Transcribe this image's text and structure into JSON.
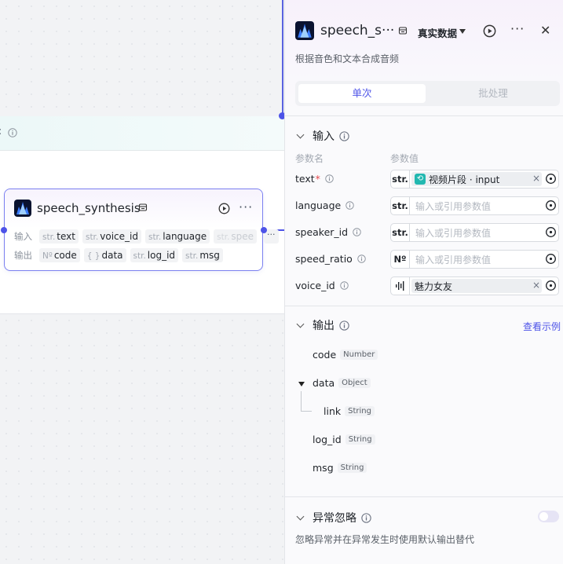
{
  "canvas": {
    "group_label_colon": ":",
    "node": {
      "title": "speech_synthesis",
      "more_label": "···",
      "input_label": "输入",
      "output_label": "输出",
      "inputs": [
        {
          "type": "str.",
          "name": "text"
        },
        {
          "type": "str.",
          "name": "voice_id"
        },
        {
          "type": "str.",
          "name": "language"
        },
        {
          "type": "str.",
          "name": "spee"
        }
      ],
      "inputs_more": "···",
      "outputs": [
        {
          "type": "Nº",
          "name": "code"
        },
        {
          "type": "{ }",
          "name": "data"
        },
        {
          "type": "str.",
          "name": "log_id"
        },
        {
          "type": "str.",
          "name": "msg"
        }
      ]
    }
  },
  "panel": {
    "title": "speech_s···",
    "mode_label": "真实数据",
    "more_label": "···",
    "close_label": "✕",
    "description": "根据音色和文本合成音频",
    "tabs": {
      "single": "单次",
      "batch": "批处理"
    },
    "input_section": {
      "title": "输入",
      "col_name": "参数名",
      "col_value": "参数值",
      "params": [
        {
          "name": "text",
          "required": "*",
          "type": "str.",
          "ref_label": "视频片段 · input",
          "clear": "×"
        },
        {
          "name": "language",
          "type": "str.",
          "placeholder": "输入或引用参数值"
        },
        {
          "name": "speaker_id",
          "type": "str.",
          "placeholder": "输入或引用参数值"
        },
        {
          "name": "speed_ratio",
          "type": "Nº",
          "placeholder": "输入或引用参数值"
        },
        {
          "name": "voice_id",
          "type": "audio",
          "value": "魅力女友",
          "clear": "×"
        }
      ]
    },
    "output_section": {
      "title": "输出",
      "example_link": "查看示例",
      "fields": [
        {
          "name": "code",
          "type": "Number"
        },
        {
          "name": "data",
          "type": "Object"
        },
        {
          "name": "link",
          "type": "String"
        },
        {
          "name": "log_id",
          "type": "String"
        },
        {
          "name": "msg",
          "type": "String"
        }
      ]
    },
    "error_section": {
      "title": "异常忽略",
      "description": "忽略异常并在异常发生时使用默认输出替代",
      "enabled": false
    }
  },
  "colors": {
    "accent": "#4d53e8",
    "required": "#e5484d",
    "ref_icon": "#22b8b0"
  }
}
